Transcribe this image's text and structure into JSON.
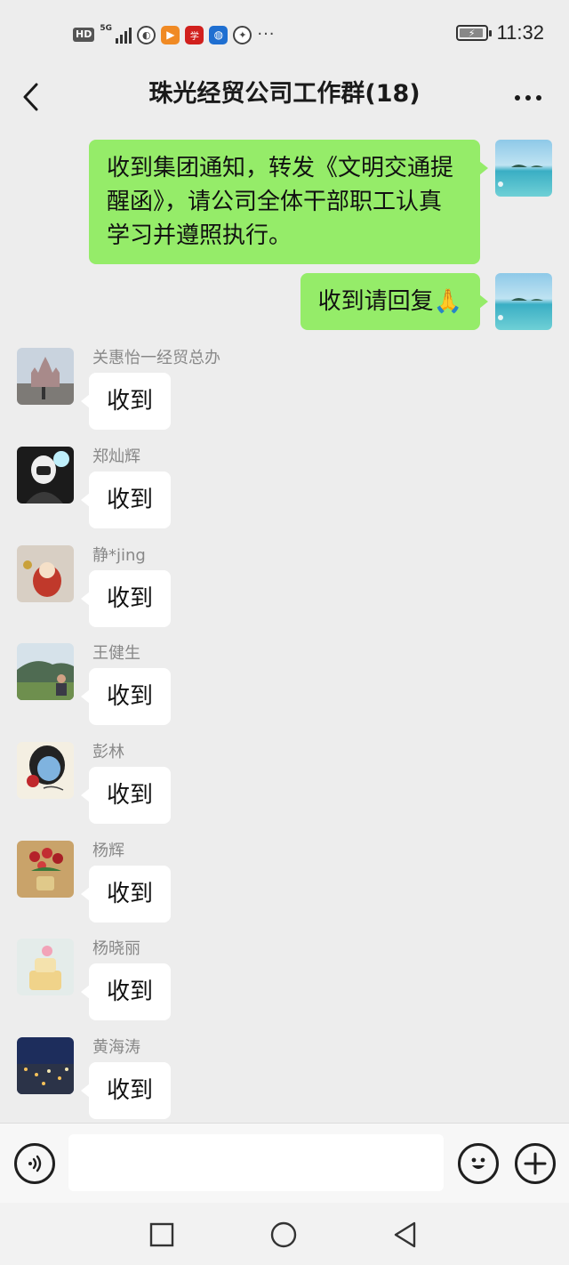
{
  "status_bar": {
    "hd_label": "HD",
    "network_label": "5G",
    "time": "11:32",
    "overflow": "···"
  },
  "header": {
    "title": "珠光经贸公司工作群(18)"
  },
  "messages": [
    {
      "direction": "sent",
      "text": "收到集团通知，转发《文明交通提醒函》，请公司全体干部职工认真学习并遵照执行。",
      "avatar": "sea-island-avatar"
    },
    {
      "direction": "sent",
      "text": "收到请回复🙏",
      "avatar": "sea-island-avatar"
    },
    {
      "direction": "received",
      "sender": "关惠怡一经贸总办",
      "text": "收到",
      "avatar": "castle-avatar"
    },
    {
      "direction": "received",
      "sender": "郑灿辉",
      "text": "收到",
      "avatar": "person-mask-avatar"
    },
    {
      "direction": "received",
      "sender": "静*jing",
      "text": "收到",
      "avatar": "daruma-avatar"
    },
    {
      "direction": "received",
      "sender": "王健生",
      "text": "收到",
      "avatar": "landscape-person-avatar"
    },
    {
      "direction": "received",
      "sender": "彭林",
      "text": "收到",
      "avatar": "cartoon-girl-avatar"
    },
    {
      "direction": "received",
      "sender": "杨辉",
      "text": "收到",
      "avatar": "flower-pot-avatar"
    },
    {
      "direction": "received",
      "sender": "杨晓丽",
      "text": "收到",
      "avatar": "cake-avatar"
    },
    {
      "direction": "received",
      "sender": "黄海涛",
      "text": "收到",
      "avatar": "night-city-avatar"
    }
  ],
  "input": {
    "value": "",
    "placeholder": ""
  },
  "colors": {
    "background": "#ededed",
    "sent_bubble": "#95ec69",
    "received_bubble": "#ffffff"
  }
}
